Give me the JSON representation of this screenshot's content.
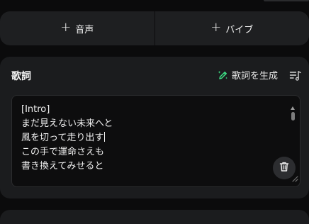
{
  "add_row": {
    "voice_label": "音声",
    "vibe_label": "バイブ",
    "plus_glyph": "+"
  },
  "lyrics": {
    "title": "歌詞",
    "generate_label": "歌詞を生成",
    "lines": [
      "[Intro]",
      "まだ見えない未来へと",
      "風を切って走り出す",
      "この手で運命さえも",
      "書き換えてみせると"
    ]
  },
  "colors": {
    "accent_green": "#3ddc84",
    "panel_bg": "#1b1c1e",
    "editor_bg": "#0d0d0e"
  },
  "icons": {
    "generate": "pencil-sparkle-icon",
    "lyrics_list": "music-list-icon",
    "trash": "trash-icon",
    "resize": "resize-grip-icon"
  }
}
